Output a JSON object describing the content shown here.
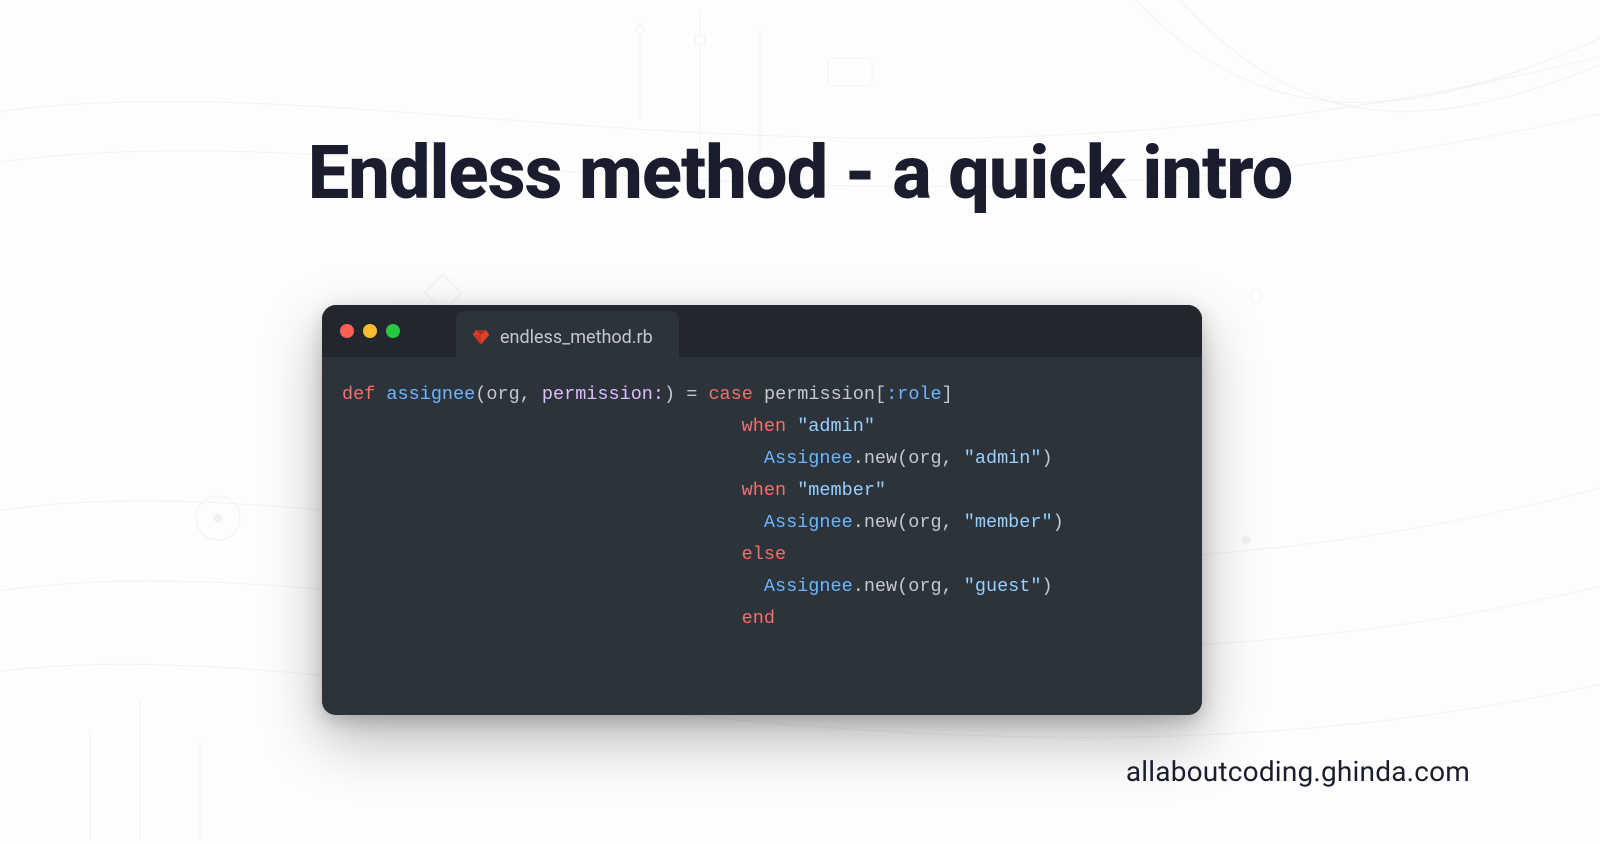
{
  "title": "Endless method - a quick intro",
  "editor": {
    "tab_filename": "endless_method.rb",
    "tab_icon": "ruby-icon",
    "ruby_icon_color": "#e0402a",
    "dots": {
      "red": "#ff5f57",
      "yellow": "#febc2e",
      "green": "#28c840"
    },
    "colors": {
      "editor_bg": "#22272e",
      "editor_body_bg": "#2d333b",
      "text": "#c5c8ce",
      "keyword": "#f47067",
      "function": "#6cb6ff",
      "symbol": "#6cb6ff",
      "label": "#dcbdfb",
      "string": "#96d0ff",
      "constant": "#6cb6ff"
    },
    "code": {
      "method_name": "assignee",
      "params_open": "(",
      "param_org": "org",
      "comma_space": ", ",
      "param_permission_kw": "permission:",
      "params_close": ")",
      "assign_eq": " = ",
      "kw_def": "def",
      "kw_case": "case",
      "expr_permission": "permission",
      "bracket_open": "[",
      "sym_role": ":role",
      "bracket_close": "]",
      "indent_case": "                                    ",
      "indent_body": "                                      ",
      "kw_when": "when",
      "str_admin": "\"admin\"",
      "str_member": "\"member\"",
      "str_guest": "\"guest\"",
      "const_assignee": "Assignee",
      "dot": ".",
      "mth_new": "new",
      "args_open": "(",
      "arg_org": "org",
      "args_comma": ", ",
      "args_close": ")",
      "kw_else": "else",
      "kw_end": "end"
    }
  },
  "watermark": "allaboutcoding.ghinda.com"
}
